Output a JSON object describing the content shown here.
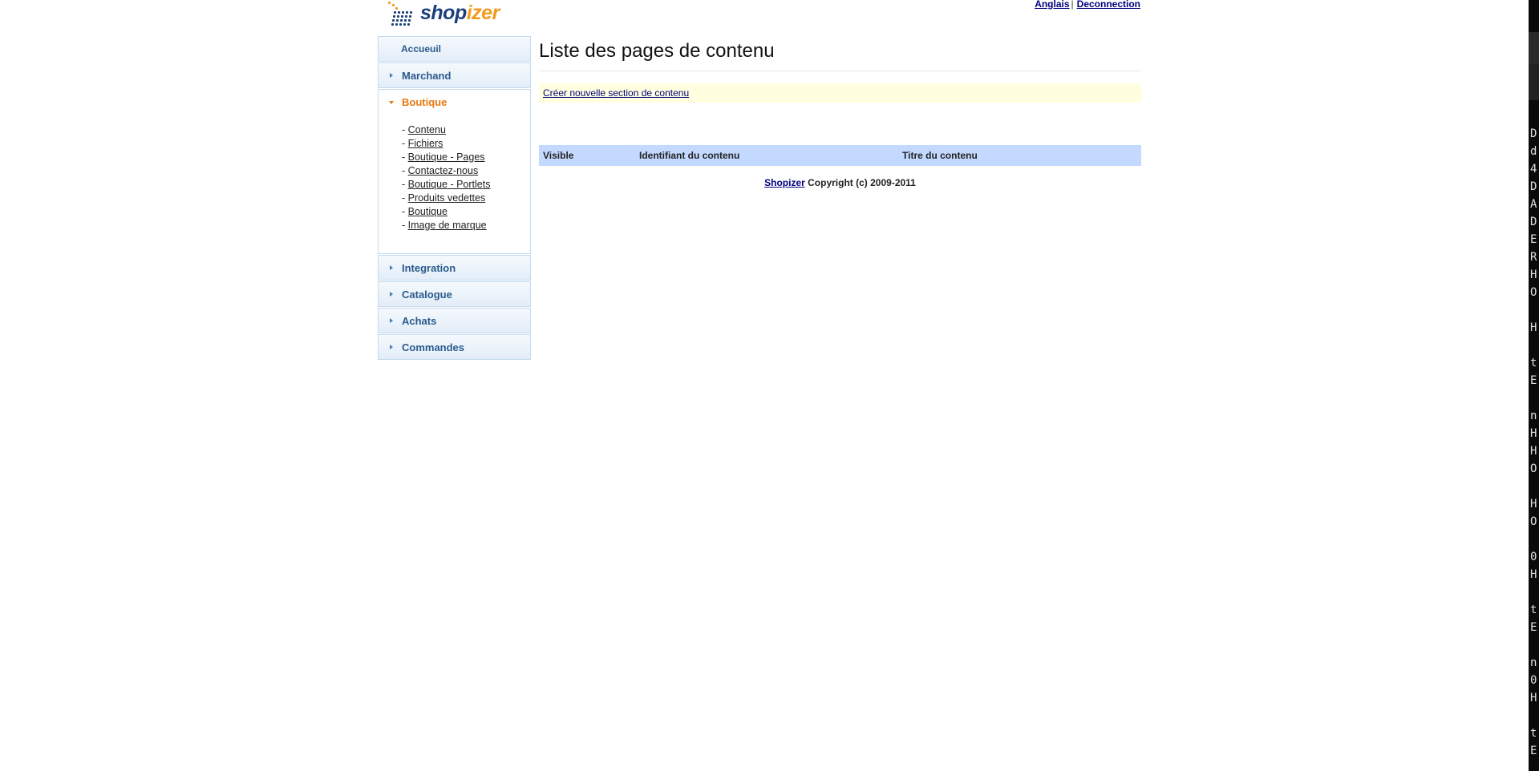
{
  "header": {
    "logo": {
      "part1": "shop",
      "part2": "izer"
    },
    "lang_link": "Anglais",
    "separator": "|",
    "logout_link": "Deconnection"
  },
  "sidebar": {
    "home": "Accueuil",
    "marchand": "Marchand",
    "boutique": "Boutique",
    "submenu": [
      "Contenu",
      "Fichiers",
      "Boutique - Pages",
      "Contactez-nous",
      "Boutique - Portlets",
      "Produits vedettes",
      "Boutique",
      "Image de marque"
    ],
    "integration": "Integration",
    "catalogue": "Catalogue",
    "achats": "Achats",
    "commandes": "Commandes"
  },
  "main": {
    "title": "Liste des pages de contenu",
    "create_link": "Créer nouvelle section de contenu",
    "table_headers": [
      "Visible",
      "Identifiant du contenu",
      "Titre du contenu"
    ]
  },
  "footer": {
    "link": "Shopizer",
    "text": " Copyright (c) 2009-2011"
  },
  "terminal": {
    "chars": [
      "D",
      "d",
      "4",
      "D",
      "A",
      "D",
      "E",
      "R",
      "H",
      "O",
      "",
      "H",
      "",
      "t",
      "E",
      "",
      "n",
      "H",
      "H",
      "O",
      "",
      "H",
      "O",
      "",
      "0",
      "H",
      "",
      "t",
      "E",
      "",
      "n",
      "0",
      "H",
      "",
      "t",
      "E"
    ]
  },
  "colors": {
    "brand_blue": "#1b3f7a",
    "brand_orange": "#f29a1f",
    "link": "#00007f",
    "nav_text": "#2a5a8c",
    "nav_active": "#e6780e",
    "table_header_bg": "#c3d9ff",
    "notice_bg": "#ffffdf"
  }
}
